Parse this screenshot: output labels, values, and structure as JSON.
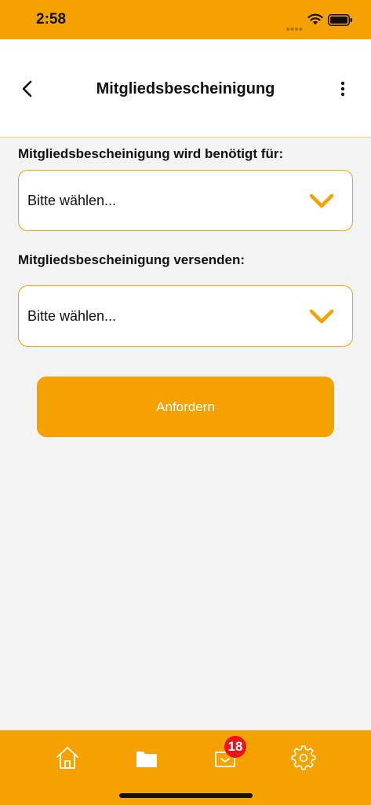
{
  "status_bar": {
    "time": "2:58"
  },
  "header": {
    "title": "Mitgliedsbescheinigung"
  },
  "form": {
    "purpose": {
      "label": "Mitgliedsbescheinigung wird benötigt für:",
      "value": "Bitte wählen..."
    },
    "delivery": {
      "label": "Mitgliedsbescheinigung versenden:",
      "value": "Bitte wählen..."
    },
    "submit_label": "Anfordern"
  },
  "tab_bar": {
    "items": [
      {
        "icon": "home-icon"
      },
      {
        "icon": "folder-icon"
      },
      {
        "icon": "mail-icon",
        "badge": "18"
      },
      {
        "icon": "gear-icon"
      }
    ]
  },
  "colors": {
    "accent": "#f5a100",
    "badge": "#e8141c",
    "background": "#f3f3f3"
  }
}
